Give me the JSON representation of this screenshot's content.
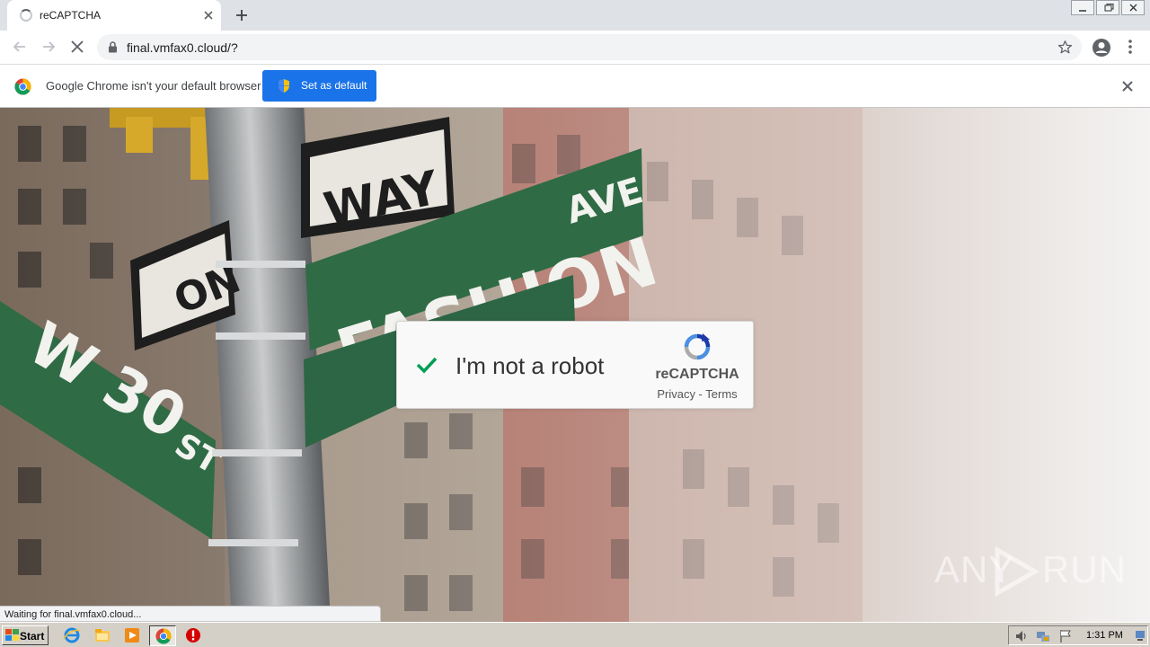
{
  "browser": {
    "tab": {
      "title": "reCAPTCHA"
    },
    "address_bar": {
      "url": "final.vmfax0.cloud/?"
    },
    "infobar": {
      "message": "Google Chrome isn't your default browser",
      "button_label": "Set as default"
    },
    "status_text": "Waiting for final.vmfax0.cloud..."
  },
  "page": {
    "signs": {
      "street1": "FASHION",
      "street1_suffix": "AVE",
      "street2": "W 30",
      "street2_suffix": "ST",
      "oneway": "WAY",
      "oneway2": "ON"
    },
    "captcha": {
      "label": "I'm not a robot",
      "brand": "reCAPTCHA",
      "links": "Privacy - Terms",
      "checked": true
    },
    "watermark": {
      "left": "ANY",
      "right": "RUN"
    }
  },
  "taskbar": {
    "start_label": "Start",
    "clock": "1:31 PM"
  },
  "colors": {
    "accent": "#1a73e8",
    "captcha_check": "#009e55",
    "sign_green": "#2f6b45"
  }
}
